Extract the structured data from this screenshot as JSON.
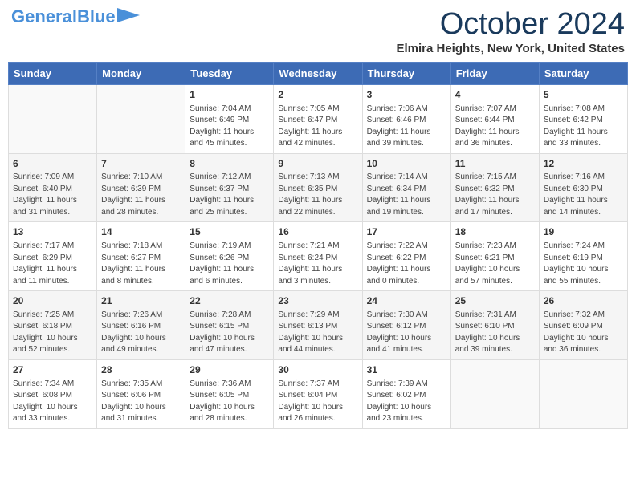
{
  "header": {
    "logo_general": "General",
    "logo_blue": "Blue",
    "month": "October 2024",
    "location": "Elmira Heights, New York, United States"
  },
  "days_of_week": [
    "Sunday",
    "Monday",
    "Tuesday",
    "Wednesday",
    "Thursday",
    "Friday",
    "Saturday"
  ],
  "weeks": [
    [
      {
        "day": "",
        "sunrise": "",
        "sunset": "",
        "daylight": ""
      },
      {
        "day": "",
        "sunrise": "",
        "sunset": "",
        "daylight": ""
      },
      {
        "day": "1",
        "sunrise": "Sunrise: 7:04 AM",
        "sunset": "Sunset: 6:49 PM",
        "daylight": "Daylight: 11 hours and 45 minutes."
      },
      {
        "day": "2",
        "sunrise": "Sunrise: 7:05 AM",
        "sunset": "Sunset: 6:47 PM",
        "daylight": "Daylight: 11 hours and 42 minutes."
      },
      {
        "day": "3",
        "sunrise": "Sunrise: 7:06 AM",
        "sunset": "Sunset: 6:46 PM",
        "daylight": "Daylight: 11 hours and 39 minutes."
      },
      {
        "day": "4",
        "sunrise": "Sunrise: 7:07 AM",
        "sunset": "Sunset: 6:44 PM",
        "daylight": "Daylight: 11 hours and 36 minutes."
      },
      {
        "day": "5",
        "sunrise": "Sunrise: 7:08 AM",
        "sunset": "Sunset: 6:42 PM",
        "daylight": "Daylight: 11 hours and 33 minutes."
      }
    ],
    [
      {
        "day": "6",
        "sunrise": "Sunrise: 7:09 AM",
        "sunset": "Sunset: 6:40 PM",
        "daylight": "Daylight: 11 hours and 31 minutes."
      },
      {
        "day": "7",
        "sunrise": "Sunrise: 7:10 AM",
        "sunset": "Sunset: 6:39 PM",
        "daylight": "Daylight: 11 hours and 28 minutes."
      },
      {
        "day": "8",
        "sunrise": "Sunrise: 7:12 AM",
        "sunset": "Sunset: 6:37 PM",
        "daylight": "Daylight: 11 hours and 25 minutes."
      },
      {
        "day": "9",
        "sunrise": "Sunrise: 7:13 AM",
        "sunset": "Sunset: 6:35 PM",
        "daylight": "Daylight: 11 hours and 22 minutes."
      },
      {
        "day": "10",
        "sunrise": "Sunrise: 7:14 AM",
        "sunset": "Sunset: 6:34 PM",
        "daylight": "Daylight: 11 hours and 19 minutes."
      },
      {
        "day": "11",
        "sunrise": "Sunrise: 7:15 AM",
        "sunset": "Sunset: 6:32 PM",
        "daylight": "Daylight: 11 hours and 17 minutes."
      },
      {
        "day": "12",
        "sunrise": "Sunrise: 7:16 AM",
        "sunset": "Sunset: 6:30 PM",
        "daylight": "Daylight: 11 hours and 14 minutes."
      }
    ],
    [
      {
        "day": "13",
        "sunrise": "Sunrise: 7:17 AM",
        "sunset": "Sunset: 6:29 PM",
        "daylight": "Daylight: 11 hours and 11 minutes."
      },
      {
        "day": "14",
        "sunrise": "Sunrise: 7:18 AM",
        "sunset": "Sunset: 6:27 PM",
        "daylight": "Daylight: 11 hours and 8 minutes."
      },
      {
        "day": "15",
        "sunrise": "Sunrise: 7:19 AM",
        "sunset": "Sunset: 6:26 PM",
        "daylight": "Daylight: 11 hours and 6 minutes."
      },
      {
        "day": "16",
        "sunrise": "Sunrise: 7:21 AM",
        "sunset": "Sunset: 6:24 PM",
        "daylight": "Daylight: 11 hours and 3 minutes."
      },
      {
        "day": "17",
        "sunrise": "Sunrise: 7:22 AM",
        "sunset": "Sunset: 6:22 PM",
        "daylight": "Daylight: 11 hours and 0 minutes."
      },
      {
        "day": "18",
        "sunrise": "Sunrise: 7:23 AM",
        "sunset": "Sunset: 6:21 PM",
        "daylight": "Daylight: 10 hours and 57 minutes."
      },
      {
        "day": "19",
        "sunrise": "Sunrise: 7:24 AM",
        "sunset": "Sunset: 6:19 PM",
        "daylight": "Daylight: 10 hours and 55 minutes."
      }
    ],
    [
      {
        "day": "20",
        "sunrise": "Sunrise: 7:25 AM",
        "sunset": "Sunset: 6:18 PM",
        "daylight": "Daylight: 10 hours and 52 minutes."
      },
      {
        "day": "21",
        "sunrise": "Sunrise: 7:26 AM",
        "sunset": "Sunset: 6:16 PM",
        "daylight": "Daylight: 10 hours and 49 minutes."
      },
      {
        "day": "22",
        "sunrise": "Sunrise: 7:28 AM",
        "sunset": "Sunset: 6:15 PM",
        "daylight": "Daylight: 10 hours and 47 minutes."
      },
      {
        "day": "23",
        "sunrise": "Sunrise: 7:29 AM",
        "sunset": "Sunset: 6:13 PM",
        "daylight": "Daylight: 10 hours and 44 minutes."
      },
      {
        "day": "24",
        "sunrise": "Sunrise: 7:30 AM",
        "sunset": "Sunset: 6:12 PM",
        "daylight": "Daylight: 10 hours and 41 minutes."
      },
      {
        "day": "25",
        "sunrise": "Sunrise: 7:31 AM",
        "sunset": "Sunset: 6:10 PM",
        "daylight": "Daylight: 10 hours and 39 minutes."
      },
      {
        "day": "26",
        "sunrise": "Sunrise: 7:32 AM",
        "sunset": "Sunset: 6:09 PM",
        "daylight": "Daylight: 10 hours and 36 minutes."
      }
    ],
    [
      {
        "day": "27",
        "sunrise": "Sunrise: 7:34 AM",
        "sunset": "Sunset: 6:08 PM",
        "daylight": "Daylight: 10 hours and 33 minutes."
      },
      {
        "day": "28",
        "sunrise": "Sunrise: 7:35 AM",
        "sunset": "Sunset: 6:06 PM",
        "daylight": "Daylight: 10 hours and 31 minutes."
      },
      {
        "day": "29",
        "sunrise": "Sunrise: 7:36 AM",
        "sunset": "Sunset: 6:05 PM",
        "daylight": "Daylight: 10 hours and 28 minutes."
      },
      {
        "day": "30",
        "sunrise": "Sunrise: 7:37 AM",
        "sunset": "Sunset: 6:04 PM",
        "daylight": "Daylight: 10 hours and 26 minutes."
      },
      {
        "day": "31",
        "sunrise": "Sunrise: 7:39 AM",
        "sunset": "Sunset: 6:02 PM",
        "daylight": "Daylight: 10 hours and 23 minutes."
      },
      {
        "day": "",
        "sunrise": "",
        "sunset": "",
        "daylight": ""
      },
      {
        "day": "",
        "sunrise": "",
        "sunset": "",
        "daylight": ""
      }
    ]
  ]
}
